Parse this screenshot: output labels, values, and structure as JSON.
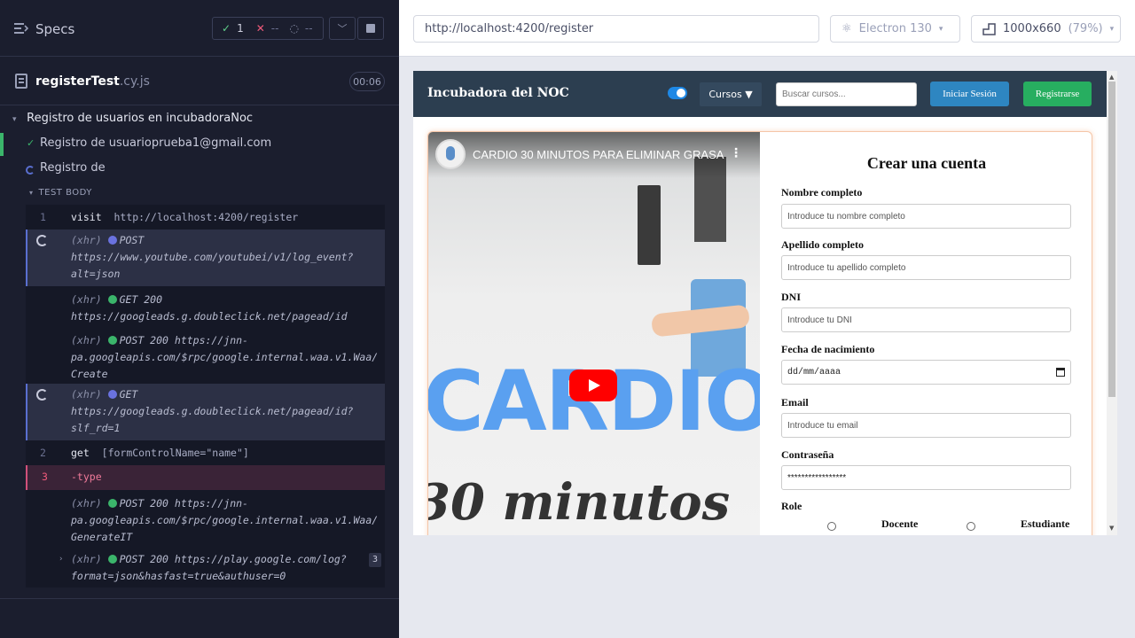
{
  "runner": {
    "specs_label": "Specs",
    "stats": {
      "passed": "1",
      "failed": "--",
      "pending": "--"
    },
    "file": {
      "name": "registerTest",
      "ext": ".cy.js",
      "duration": "00:06"
    },
    "suite_title": "Registro de usuarios en incubadoraNoc",
    "tests": [
      {
        "label": "Registro de usuarioprueba1@gmail.com",
        "state": "passed"
      },
      {
        "label": "Registro de",
        "state": "running"
      }
    ],
    "test_body_label": "TEST BODY",
    "commands": [
      {
        "num": "1",
        "name": "visit",
        "arg": "http://localhost:4200/register"
      },
      {
        "tag": "(xhr)",
        "method": "POST",
        "lines": [
          "https://www.youtube.com/youtubei/v1/log_event?",
          "alt=json"
        ]
      },
      {
        "tag": "(xhr)",
        "method": "GET 200",
        "lines": [
          "https://googleads.g.doubleclick.net/pagead/id"
        ]
      },
      {
        "tag": "(xhr)",
        "method": "POST 200",
        "first": "https://jnn-",
        "lines": [
          "pa.googleapis.com/$rpc/google.internal.waa.v1.Waa/",
          "Create"
        ]
      },
      {
        "tag": "(xhr)",
        "method": "GET",
        "lines": [
          "https://googleads.g.doubleclick.net/pagead/id?",
          "slf_rd=1"
        ]
      },
      {
        "num": "2",
        "name": "get",
        "arg": "[formControlName=\"name\"]"
      },
      {
        "num": "3",
        "name": "-type",
        "arg": ""
      },
      {
        "tag": "(xhr)",
        "method": "POST 200",
        "first": "https://jnn-",
        "lines": [
          "pa.googleapis.com/$rpc/google.internal.waa.v1.Waa/",
          "GenerateIT"
        ]
      },
      {
        "tag": "(xhr)",
        "method": "POST 200",
        "first": "https://play.google.com/log?",
        "lines": [
          "format=json&hasfast=true&authuser=0"
        ],
        "count": "3"
      }
    ]
  },
  "browser": {
    "url": "http://localhost:4200/register",
    "browser_name": "Electron 130",
    "viewport": "1000x660",
    "zoom": "(79%)"
  },
  "app": {
    "brand": "Incubadora del NOC",
    "cursos_label": "Cursos ▼",
    "search_placeholder": "Buscar cursos...",
    "login_label": "Iniciar Sesión",
    "register_label": "Registrarse",
    "video": {
      "title": "CARDIO 30 MINUTOS PARA ELIMINAR GRASA",
      "big_text": "CARDIO",
      "sub_text": "30 minutos"
    },
    "form": {
      "title": "Crear una cuenta",
      "fields": [
        {
          "label": "Nombre completo",
          "placeholder": "Introduce tu nombre completo"
        },
        {
          "label": "Apellido completo",
          "placeholder": "Introduce tu apellido completo"
        },
        {
          "label": "DNI",
          "placeholder": "Introduce tu DNI"
        },
        {
          "label": "Fecha de nacimiento",
          "value": "dd/mm/aaaa"
        },
        {
          "label": "Email",
          "placeholder": "Introduce tu email"
        },
        {
          "label": "Contraseña",
          "value": "*****************"
        }
      ],
      "role_label": "Role",
      "roles": [
        "Docente",
        "Estudiante"
      ]
    }
  },
  "colors": {
    "runner_bg": "#1b1e2e",
    "pass": "#3bb56b",
    "fail": "#f05a7a",
    "nav_bg": "#2c3e50",
    "login_btn": "#2e86c1",
    "register_btn": "#27ae60"
  }
}
